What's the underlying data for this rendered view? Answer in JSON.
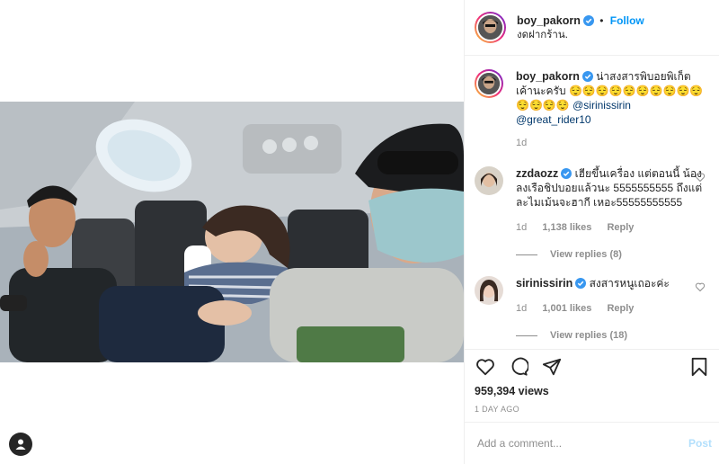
{
  "post": {
    "username": "boy_pakorn",
    "follow_label": "Follow",
    "dot": "•",
    "location": "งดฝากร้าน.",
    "caption": {
      "username": "boy_pakorn",
      "text": "น่าสงสารพิบอยพิเก็ตเค้านะครับ 😌😌😌😌😌😌😌😌😌😌😌😌😌😌",
      "mentions": "@sirinissirin @great_rider10",
      "time": "1d"
    },
    "comments": [
      {
        "username": "zzdaozz",
        "text": "เฮียขึ้นเครื่อง แต่ตอนนี้ น้องลงเรือชิปบอยแล้วนะ 5555555555 ถึงแต่ละไมเม้นจะฮากี เหอะ55555555555",
        "time": "1d",
        "likes": "1,138 likes",
        "reply": "Reply",
        "view_replies": "View replies (8)"
      },
      {
        "username": "sirinissirin",
        "text": "สงสารหนูเถอะค่ะ",
        "time": "1d",
        "likes": "1,001 likes",
        "reply": "Reply",
        "view_replies": "View replies (18)"
      }
    ],
    "views": "959,394 views",
    "posted_ago": "1 DAY AGO",
    "comment_placeholder": "Add a comment...",
    "post_label": "Post"
  },
  "colors": {
    "link": "#0095f6",
    "verified": "#3897f0",
    "muted": "#8e8e8e",
    "post_disabled": "#b2dffc"
  },
  "icons": [
    "verified-badge-icon",
    "heart-icon",
    "comment-icon",
    "share-icon",
    "bookmark-icon",
    "user-tag-icon"
  ]
}
